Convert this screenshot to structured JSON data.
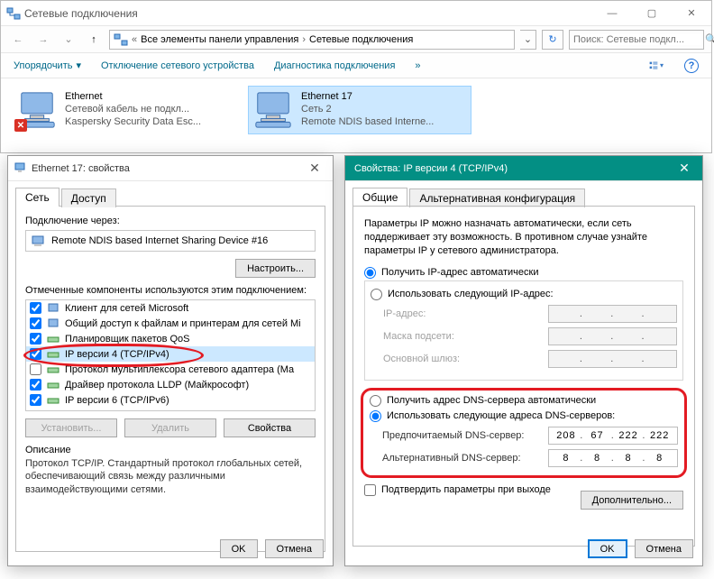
{
  "window": {
    "title": "Сетевые подключения",
    "breadcrumb": {
      "root": "Все элементы панели управления",
      "current": "Сетевые подключения"
    },
    "search_placeholder": "Поиск: Сетевые подкл..."
  },
  "cmdbar": {
    "organize": "Упорядочить",
    "disable": "Отключение сетевого устройства",
    "diagnose": "Диагностика подключения"
  },
  "connections": [
    {
      "name": "Ethernet",
      "status": "Сетевой кабель не подкл...",
      "device": "Kaspersky Security Data Esc...",
      "error": true
    },
    {
      "name": "Ethernet 17",
      "status": "Сеть 2",
      "device": "Remote NDIS based Interne...",
      "error": false
    }
  ],
  "props_dialog": {
    "title": "Ethernet 17: свойства",
    "tabs": {
      "network": "Сеть",
      "access": "Доступ"
    },
    "connect_via_label": "Подключение через:",
    "device": "Remote NDIS based Internet Sharing Device #16",
    "configure_btn": "Настроить...",
    "components_label": "Отмеченные компоненты используются этим подключением:",
    "components": [
      {
        "label": "Клиент для сетей Microsoft",
        "checked": true
      },
      {
        "label": "Общий доступ к файлам и принтерам для сетей Mi",
        "checked": true
      },
      {
        "label": "Планировщик пакетов QoS",
        "checked": true
      },
      {
        "label": "IP версии 4 (TCP/IPv4)",
        "checked": true,
        "selected": true
      },
      {
        "label": "Протокол мультиплексора сетевого адаптера (Ма",
        "checked": false
      },
      {
        "label": "Драйвер протокола LLDP (Майкрософт)",
        "checked": true
      },
      {
        "label": "IP версии 6 (TCP/IPv6)",
        "checked": true
      }
    ],
    "install_btn": "Установить...",
    "uninstall_btn": "Удалить",
    "properties_btn": "Свойства",
    "desc_label": "Описание",
    "desc_text": "Протокол TCP/IP. Стандартный протокол глобальных сетей, обеспечивающий связь между различными взаимодействующими сетями.",
    "ok": "OK",
    "cancel": "Отмена"
  },
  "ipv4_dialog": {
    "title": "Свойства: IP версии 4 (TCP/IPv4)",
    "tabs": {
      "general": "Общие",
      "alt": "Альтернативная конфигурация"
    },
    "note": "Параметры IP можно назначать автоматически, если сеть поддерживает эту возможность. В противном случае узнайте параметры IP у сетевого администратора.",
    "ip_auto": "Получить IP-адрес автоматически",
    "ip_manual": "Использовать следующий IP-адрес:",
    "ip_addr_label": "IP-адрес:",
    "mask_label": "Маска подсети:",
    "gateway_label": "Основной шлюз:",
    "dns_auto": "Получить адрес DNS-сервера автоматически",
    "dns_manual": "Использовать следующие адреса DNS-серверов:",
    "dns_pref_label": "Предпочитаемый DNS-сервер:",
    "dns_alt_label": "Альтернативный DNS-сервер:",
    "dns_pref_value": [
      "208",
      "67",
      "222",
      "222"
    ],
    "dns_alt_value": [
      "8",
      "8",
      "8",
      "8"
    ],
    "confirm_on_exit": "Подтвердить параметры при выходе",
    "advanced_btn": "Дополнительно...",
    "ok": "OK",
    "cancel": "Отмена"
  }
}
